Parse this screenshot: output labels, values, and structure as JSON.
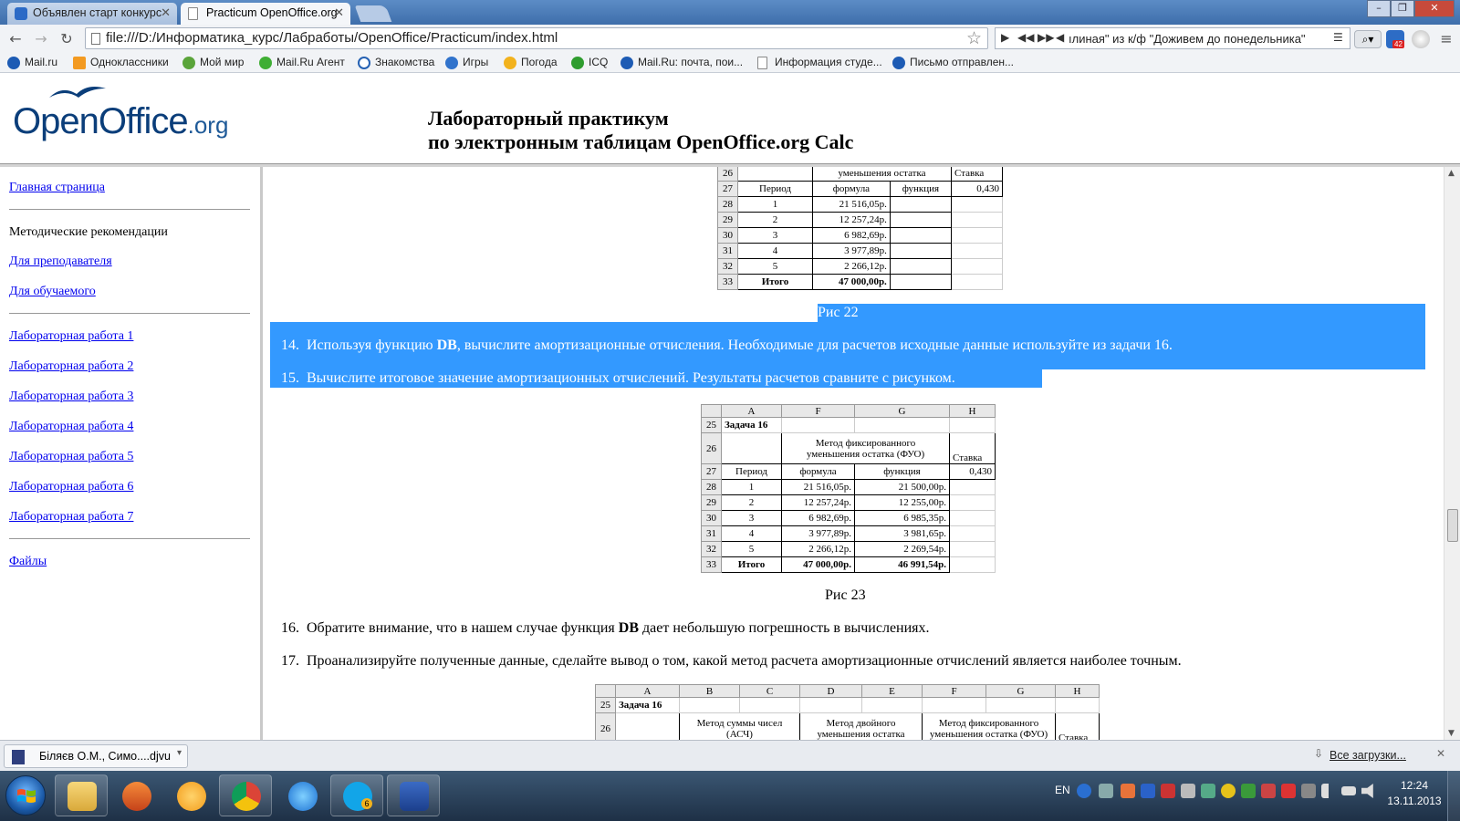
{
  "browser": {
    "tabs": [
      {
        "title": "Объявлен старт конкурс",
        "active": false
      },
      {
        "title": "Practicum OpenOffice.org",
        "active": true
      }
    ],
    "url": "file:///D:/Информатика_курс/Лабработы/OpenOffice/Practicum/index.html",
    "media_track": "ıлиная\" из к/ф \"Доживем до понедельника\"",
    "bookmarks": [
      "Mail.ru",
      "Одноклассники",
      "Мой мир",
      "Mail.Ru Агент",
      "Знакомства",
      "Игры",
      "Погода",
      "ICQ",
      "Mail.Ru: почта, пои...",
      "Информация студе...",
      "Письмо отправлен..."
    ],
    "mail_badge": "42"
  },
  "header": {
    "logo_main": "OpenOffice",
    "logo_suffix": ".org",
    "title_line1": "Лабораторный практикум",
    "title_line2": "по электронным таблицам OpenOffice.org Calc"
  },
  "sidebar": {
    "home": "Главная страница",
    "methods_heading": "Методические рекомендации",
    "for_teacher": "Для преподавателя",
    "for_student": "Для обучаемого",
    "labs": [
      "Лабораторная работа 1",
      "Лабораторная работа 2",
      "Лабораторная работа 3",
      "Лабораторная работа 4",
      "Лабораторная работа 5",
      "Лабораторная работа 6",
      "Лабораторная работа 7"
    ],
    "files": "Файлы"
  },
  "content": {
    "table22": {
      "header_partial": "уменьшения остатка",
      "rate_label": "Ставка",
      "col_period": "Период",
      "col_formula": "формула",
      "col_function": "функция",
      "rate": "0,430",
      "rows": [
        {
          "n": "28",
          "p": "1",
          "f": "21 516,05р."
        },
        {
          "n": "29",
          "p": "2",
          "f": "12 257,24р."
        },
        {
          "n": "30",
          "p": "3",
          "f": "6 982,69р."
        },
        {
          "n": "31",
          "p": "4",
          "f": "3 977,89р."
        },
        {
          "n": "32",
          "p": "5",
          "f": "2 266,12р."
        }
      ],
      "total_label": "Итого",
      "total_formula": "47 000,00р."
    },
    "caption22": "Рис 22",
    "item14_num": "14.",
    "item14_pre": "Используя функцию ",
    "item14_bold": "DB",
    "item14_post": ", вычислите амортизационные отчисления. Необходимые для расчетов исходные данные используйте из задачи 16.",
    "item15_num": "15.",
    "item15_text": "Вычислите итоговое значение амортизационных отчислений. Результаты расчетов сравните с рисунком.",
    "table23": {
      "cols": [
        "A",
        "F",
        "G",
        "H"
      ],
      "task": "Задача 16",
      "method_line1": "Метод фиксированного",
      "method_line2": "уменьшения остатка (ФУО)",
      "rate_label": "Ставка",
      "col_period": "Период",
      "col_formula": "формула",
      "col_function": "функция",
      "rate": "0,430",
      "rows": [
        {
          "n": "28",
          "p": "1",
          "f": "21 516,05р.",
          "g": "21 500,00р."
        },
        {
          "n": "29",
          "p": "2",
          "f": "12 257,24р.",
          "g": "12 255,00р."
        },
        {
          "n": "30",
          "p": "3",
          "f": "6 982,69р.",
          "g": "6 985,35р."
        },
        {
          "n": "31",
          "p": "4",
          "f": "3 977,89р.",
          "g": "3 981,65р."
        },
        {
          "n": "32",
          "p": "5",
          "f": "2 266,12р.",
          "g": "2 269,54р."
        }
      ],
      "total_label": "Итого",
      "total_formula": "47 000,00р.",
      "total_function": "46 991,54р."
    },
    "caption23": "Рис 23",
    "item16_num": "16.",
    "item16_pre": "Обратите внимание, что в нашем случае функция ",
    "item16_bold": "DB",
    "item16_post": " дает небольшую погрешность в вычислениях.",
    "item17_num": "17.",
    "item17_text": "Проанализируйте полученные данные, сделайте вывод о том, какой метод расчета амортизационные отчислений является наиболее точным.",
    "table24": {
      "cols": [
        "A",
        "B",
        "C",
        "D",
        "E",
        "F",
        "G",
        "H"
      ],
      "task": "Задача 16",
      "m1_line1": "Метод суммы чисел",
      "m1_line2": "(АСЧ)",
      "m2_line1": "Метод двойного",
      "m2_line2": "уменьшения остатка",
      "m3_line1": "Метод фиксированного",
      "m3_line2": "уменьшения остатка (ФУО)",
      "rate_label": "Ставка"
    }
  },
  "downloads": {
    "file": "Біляєв О.М., Симо....djvu",
    "all": "Все загрузки..."
  },
  "taskbar": {
    "lang": "EN",
    "time": "12:24",
    "date": "13.11.2013",
    "skype_badge": "6"
  }
}
